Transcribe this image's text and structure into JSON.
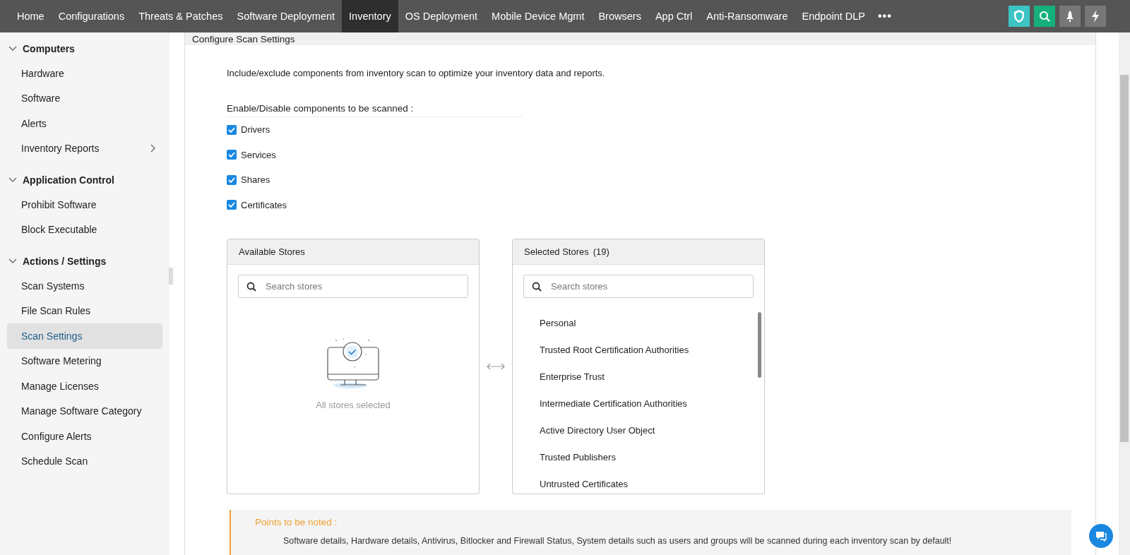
{
  "nav": {
    "tabs": [
      {
        "label": "Home",
        "selected": false
      },
      {
        "label": "Configurations",
        "selected": false
      },
      {
        "label": "Threats & Patches",
        "selected": false
      },
      {
        "label": "Software Deployment",
        "selected": false
      },
      {
        "label": "Inventory",
        "selected": true
      },
      {
        "label": "OS Deployment",
        "selected": false
      },
      {
        "label": "Mobile Device Mgmt",
        "selected": false
      },
      {
        "label": "Browsers",
        "selected": false
      },
      {
        "label": "App Ctrl",
        "selected": false
      },
      {
        "label": "Anti-Ransomware",
        "selected": false
      },
      {
        "label": "Endpoint DLP",
        "selected": false
      }
    ],
    "more": "•••"
  },
  "sidebar": {
    "groups": [
      {
        "title": "Computers",
        "expanded": true,
        "items": [
          {
            "label": "Hardware",
            "selected": false,
            "submenu": false
          },
          {
            "label": "Software",
            "selected": false,
            "submenu": false
          },
          {
            "label": "Alerts",
            "selected": false,
            "submenu": false
          },
          {
            "label": "Inventory Reports",
            "selected": false,
            "submenu": true
          }
        ]
      },
      {
        "title": "Application Control",
        "expanded": true,
        "items": [
          {
            "label": "Prohibit Software",
            "selected": false,
            "submenu": false
          },
          {
            "label": "Block Executable",
            "selected": false,
            "submenu": false
          }
        ]
      },
      {
        "title": "Actions / Settings",
        "expanded": true,
        "items": [
          {
            "label": "Scan Systems",
            "selected": false,
            "submenu": false
          },
          {
            "label": "File Scan Rules",
            "selected": false,
            "submenu": false
          },
          {
            "label": "Scan Settings",
            "selected": true,
            "submenu": false
          },
          {
            "label": "Software Metering",
            "selected": false,
            "submenu": false
          },
          {
            "label": "Manage Licenses",
            "selected": false,
            "submenu": false
          },
          {
            "label": "Manage Software Category",
            "selected": false,
            "submenu": false
          },
          {
            "label": "Configure Alerts",
            "selected": false,
            "submenu": false
          },
          {
            "label": "Schedule Scan",
            "selected": false,
            "submenu": false
          }
        ]
      }
    ]
  },
  "content": {
    "title": "Configure Scan Settings",
    "description": "Include/exclude components from inventory scan to optimize your inventory data and reports.",
    "components_label": "Enable/Disable components to be scanned :",
    "components": [
      {
        "label": "Drivers",
        "checked": true
      },
      {
        "label": "Services",
        "checked": true
      },
      {
        "label": "Shares",
        "checked": true
      },
      {
        "label": "Certificates",
        "checked": true
      }
    ],
    "available_stores": {
      "title": "Available Stores",
      "search_placeholder": "Search stores",
      "empty_text": "All stores selected"
    },
    "selected_stores": {
      "title": "Selected Stores",
      "count": "(19)",
      "search_placeholder": "Search stores",
      "items": [
        "Personal",
        "Trusted Root Certification Authorities",
        "Enterprise Trust",
        "Intermediate Certification Authorities",
        "Active Directory User Object",
        "Trusted Publishers",
        "Untrusted Certificates"
      ]
    },
    "notes": {
      "title": "Points to be noted :",
      "items": [
        "Software details, Hardware details, Antivirus, Bitlocker and Firewall Status, System details such as users and groups will be scanned during each inventory scan by default!"
      ]
    }
  }
}
